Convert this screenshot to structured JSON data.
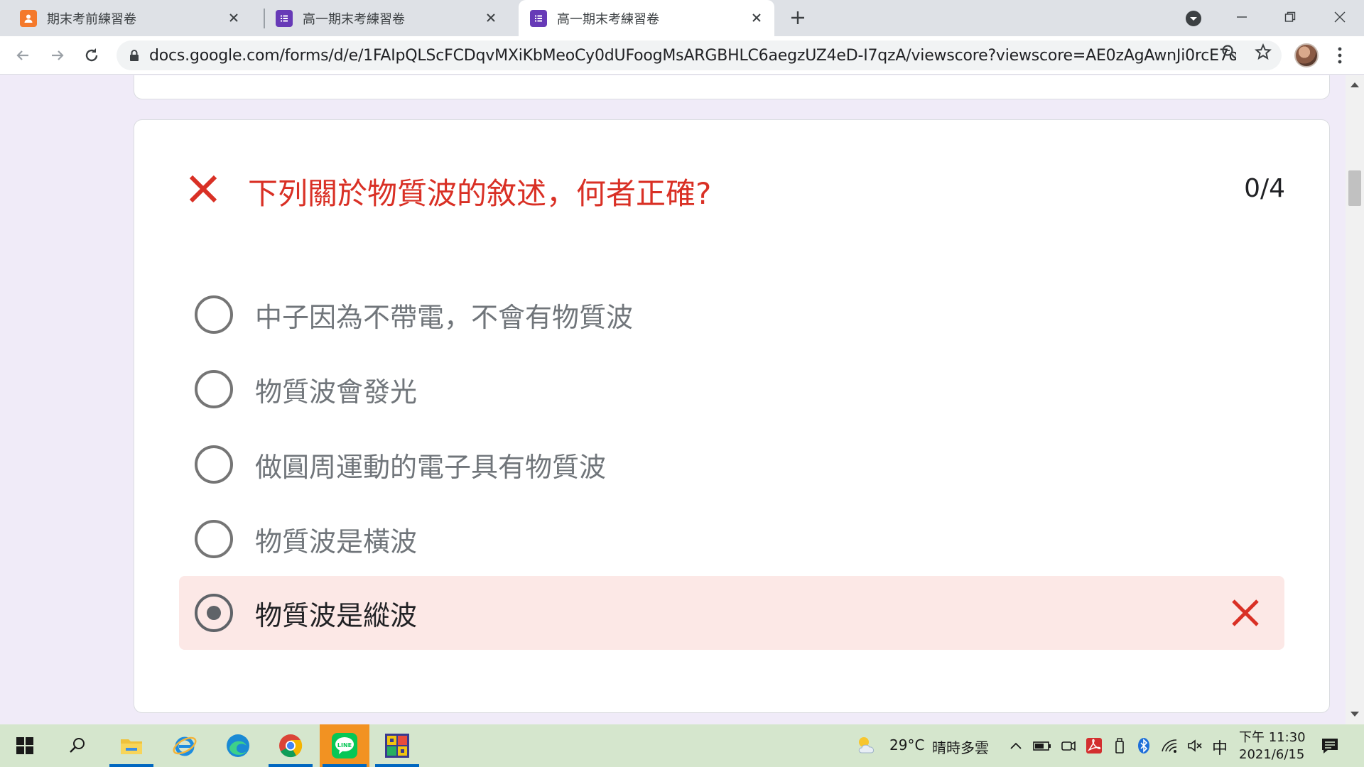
{
  "browser": {
    "tabs": [
      {
        "title": "期末考前練習卷",
        "favicon": "forms-orange-icon",
        "active": false
      },
      {
        "title": "高一期末考練習卷",
        "favicon": "forms-purple-icon",
        "active": false
      },
      {
        "title": "高一期末考練習卷",
        "favicon": "forms-purple-icon",
        "active": true
      }
    ],
    "url": "docs.google.com/forms/d/e/1FAIpQLScFCDqvMXiKbMeoCy0dUFoogMsARGBHLC6aegzUZ4eD-I7qzA/viewscore?viewscore=AE0zAgAwnJi0rcE7oTU..."
  },
  "question": {
    "title": "下列關於物質波的敘述，何者正確?",
    "score": "0/4",
    "status": "incorrect",
    "options": [
      {
        "label": "中子因為不帶電，不會有物質波",
        "selected": false
      },
      {
        "label": "物質波會發光",
        "selected": false
      },
      {
        "label": "做圓周運動的電子具有物質波",
        "selected": false
      },
      {
        "label": "物質波是橫波",
        "selected": false
      },
      {
        "label": "物質波是縱波",
        "selected": true,
        "result": "wrong"
      }
    ]
  },
  "taskbar": {
    "weather": {
      "temp": "29°C",
      "desc": "晴時多雲"
    },
    "ime": "中",
    "time": "下午 11:30",
    "date": "2021/6/15"
  },
  "colors": {
    "wrong": "#d93025",
    "wrong_bg": "#fce8e6",
    "form_bg": "#f0ebf8",
    "taskbar": "#d5e6cd"
  }
}
